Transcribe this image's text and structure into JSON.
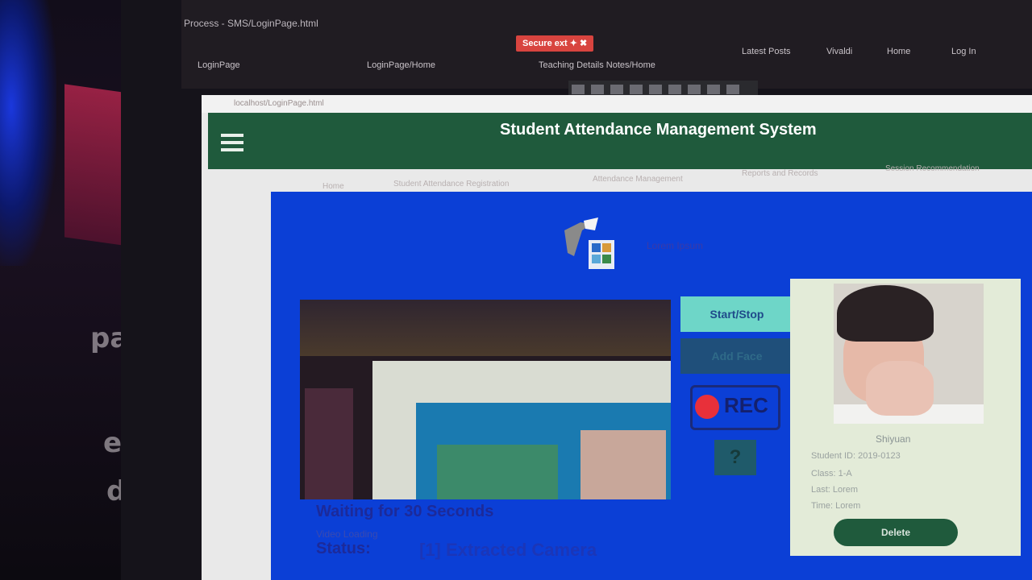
{
  "browser": {
    "window_title": "Process - SMS/LoginPage.html",
    "active_tab_label": "Secure ext ✦ ✖",
    "tabs": [
      "LoginPage",
      "LoginPage/Home",
      "Teaching Details Notes/Home"
    ],
    "toolbar_items": [
      "Latest Posts",
      "Vivaldi",
      "Home",
      "Log In"
    ],
    "address": "localhost/LoginPage.html"
  },
  "app": {
    "title": "Student Attendance Management System",
    "nav": [
      "Home",
      "Student Attendance Registration",
      "Attendance Management",
      "Reports and Records",
      "Session Recommendation"
    ],
    "logo_link": "Lorem Ipsum"
  },
  "controls": {
    "start_stop_label": "Start/Stop",
    "add_face_label": "Add Face",
    "rec_label": "REC",
    "help_label": "?"
  },
  "captions": {
    "line1": "Waiting for 30 Seconds",
    "line2": "Video Loading",
    "line3": "Status:",
    "line4": "[1] Extracted Camera"
  },
  "student_card": {
    "name": "Shiyuan",
    "details": [
      "Student ID: 2019-0123",
      "Class: 1-A",
      "Last: Lorem",
      "Time: Lorem"
    ],
    "delete_label": "Delete"
  },
  "colors": {
    "header_green": "#1f5a3c",
    "panel_blue": "#0b3fd6",
    "rec_red": "#e8303a"
  }
}
